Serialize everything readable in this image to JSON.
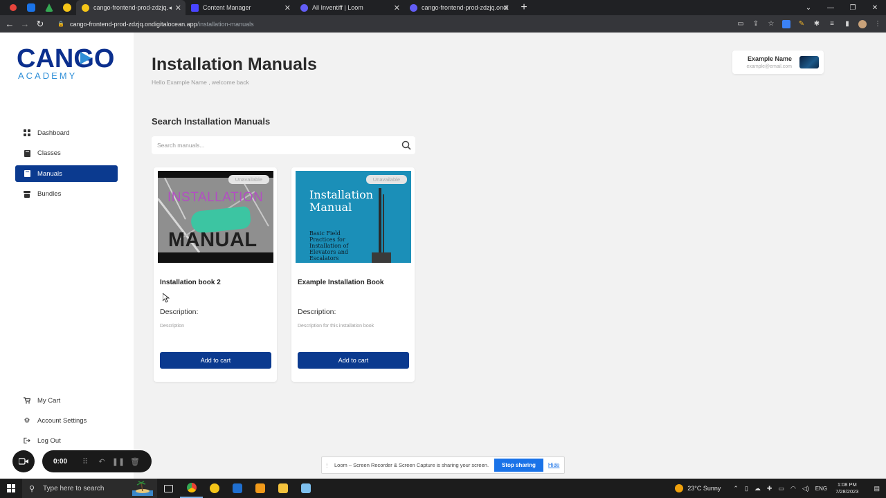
{
  "browser": {
    "tabs": [
      {
        "title": "cango-frontend-prod-zdzjq.",
        "active": true,
        "favicon_color": "#f5c518"
      },
      {
        "title": "Content Manager",
        "active": false,
        "favicon_color": "#4945ff"
      },
      {
        "title": "All Inventiff | Loom",
        "active": false,
        "favicon_color": "#625df5"
      },
      {
        "title": "cango-frontend-prod-zdzjq.ondi",
        "active": false,
        "favicon_color": "#625df5"
      }
    ],
    "url_host": "cango-frontend-prod-zdzjq.ondigitalocean.app",
    "url_path": "/installation-manuals"
  },
  "sidebar": {
    "logo_text": "CANGO",
    "logo_sub": "ACADEMY",
    "items": [
      {
        "label": "Dashboard",
        "icon": "grid-icon",
        "active": false
      },
      {
        "label": "Classes",
        "icon": "book-icon",
        "active": false
      },
      {
        "label": "Manuals",
        "icon": "book-icon",
        "active": true
      },
      {
        "label": "Bundles",
        "icon": "box-icon",
        "active": false
      }
    ],
    "bottom_items": [
      {
        "label": "My Cart",
        "icon": "cart-icon"
      },
      {
        "label": "Account Settings",
        "icon": "gear-icon"
      },
      {
        "label": "Log Out",
        "icon": "logout-icon"
      }
    ]
  },
  "header": {
    "title": "Installation Manuals",
    "subtitle": "Hello Example Name , welcome back",
    "user_name": "Example Name",
    "user_email": "example@email.com"
  },
  "search": {
    "heading": "Search Installation Manuals",
    "placeholder": "Search manuals..."
  },
  "manuals": [
    {
      "status": "Unavailable",
      "cover_line1": "INSTALLATION",
      "cover_line2": "MANUAL",
      "title": "Installation book 2",
      "description_label": "Description:",
      "description": "Description",
      "button": "Add to cart"
    },
    {
      "status": "Unavailable",
      "cover_line1": "Installation Manual",
      "cover_line2": "Basic Field Practices for Installation of Elevators and Escalators",
      "title": "Example Installation Book",
      "description_label": "Description:",
      "description": "Description for this installation book",
      "button": "Add to cart"
    }
  ],
  "loom": {
    "timer": "0:00",
    "share_text": "Loom – Screen Recorder & Screen Capture is sharing your screen.",
    "stop_label": "Stop sharing",
    "hide_label": "Hide"
  },
  "taskbar": {
    "search_placeholder": "Type here to search",
    "weather": "23°C  Sunny",
    "language": "ENG",
    "time": "1:08 PM",
    "date": "7/28/2023"
  },
  "colors": {
    "primary": "#0b3a8f",
    "brand_logo": "#0b2f8e",
    "background": "#f2f2f2"
  }
}
